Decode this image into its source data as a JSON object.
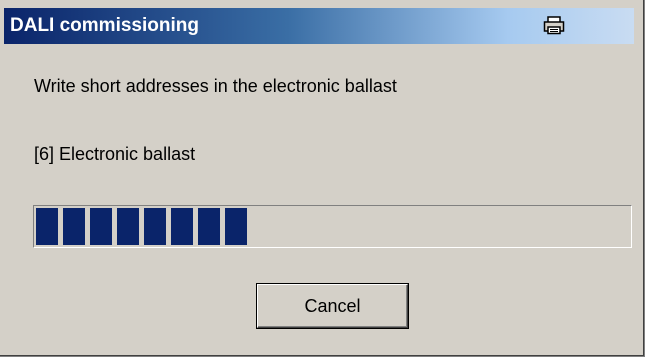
{
  "window": {
    "title": "DALI commissioning",
    "title_icon": "print-icon"
  },
  "content": {
    "message": "Write short addresses in the electronic ballast",
    "current_item": "[6] Electronic ballast"
  },
  "progress": {
    "filled_segments": 8,
    "fraction": 0.37,
    "bar_color": "#0a246a"
  },
  "buttons": {
    "cancel_label": "Cancel"
  },
  "colors": {
    "dialog_background": "#d4d0c8",
    "title_gradient_start": "#0a246a",
    "title_gradient_end": "#c9dcf2"
  }
}
